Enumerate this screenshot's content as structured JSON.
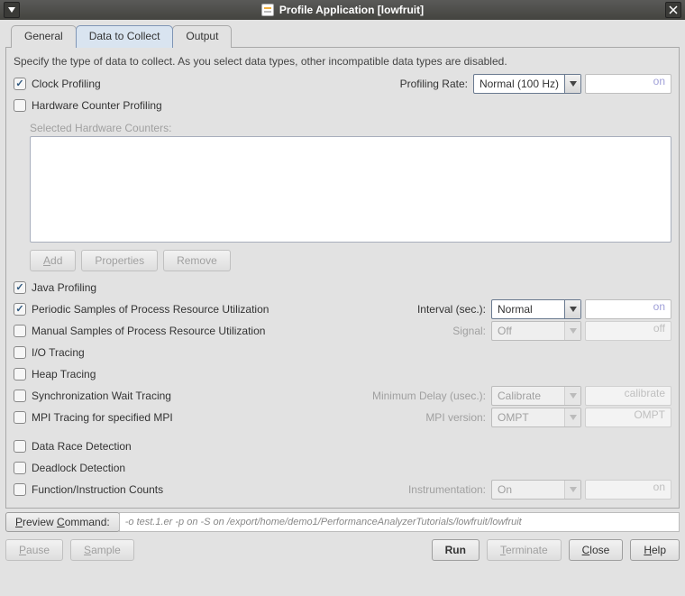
{
  "window": {
    "title": "Profile Application [lowfruit]"
  },
  "tabs": {
    "general": "General",
    "data": "Data to Collect",
    "output": "Output"
  },
  "instruction": "Specify the type of data to collect.  As you select data types, other incompatible data types are disabled.",
  "clock": {
    "label": "Clock Profiling",
    "rateLabel": "Profiling Rate:",
    "rateSelected": "Normal (100 Hz)",
    "rateValue": "on"
  },
  "hwc": {
    "label": "Hardware Counter Profiling",
    "selLabel": "Selected Hardware Counters:",
    "add": "Add",
    "props": "Properties",
    "remove": "Remove"
  },
  "java": {
    "label": "Java Profiling"
  },
  "periodic": {
    "label": "Periodic Samples of Process Resource Utilization",
    "intervalLabel": "Interval (sec.):",
    "intervalSelected": "Normal",
    "intervalValue": "on"
  },
  "manual": {
    "label": "Manual Samples of Process Resource Utilization",
    "signalLabel": "Signal:",
    "signalSelected": "Off",
    "signalValue": "off"
  },
  "io": {
    "label": "I/O Tracing"
  },
  "heap": {
    "label": "Heap Tracing"
  },
  "sync": {
    "label": "Synchronization Wait Tracing",
    "delayLabel": "Minimum Delay (usec.):",
    "delaySelected": "Calibrate",
    "delayValue": "calibrate"
  },
  "mpi": {
    "label": "MPI Tracing for specified MPI",
    "verLabel": "MPI version:",
    "verSelected": "OMPT",
    "verValue": "OMPT"
  },
  "datarace": {
    "label": "Data Race Detection"
  },
  "deadlock": {
    "label": "Deadlock Detection"
  },
  "funccount": {
    "label": "Function/Instruction Counts",
    "instrLabel": "Instrumentation:",
    "instrSelected": "On",
    "instrValue": "on"
  },
  "preview": {
    "btn": "Preview Command:",
    "text": "-o test.1.er -p on -S on /export/home/demo1/PerformanceAnalyzerTutorials/lowfruit/lowfruit"
  },
  "actions": {
    "pause": "Pause",
    "sample": "Sample",
    "run": "Run",
    "terminate": "Terminate",
    "close": "Close",
    "help": "Help"
  }
}
